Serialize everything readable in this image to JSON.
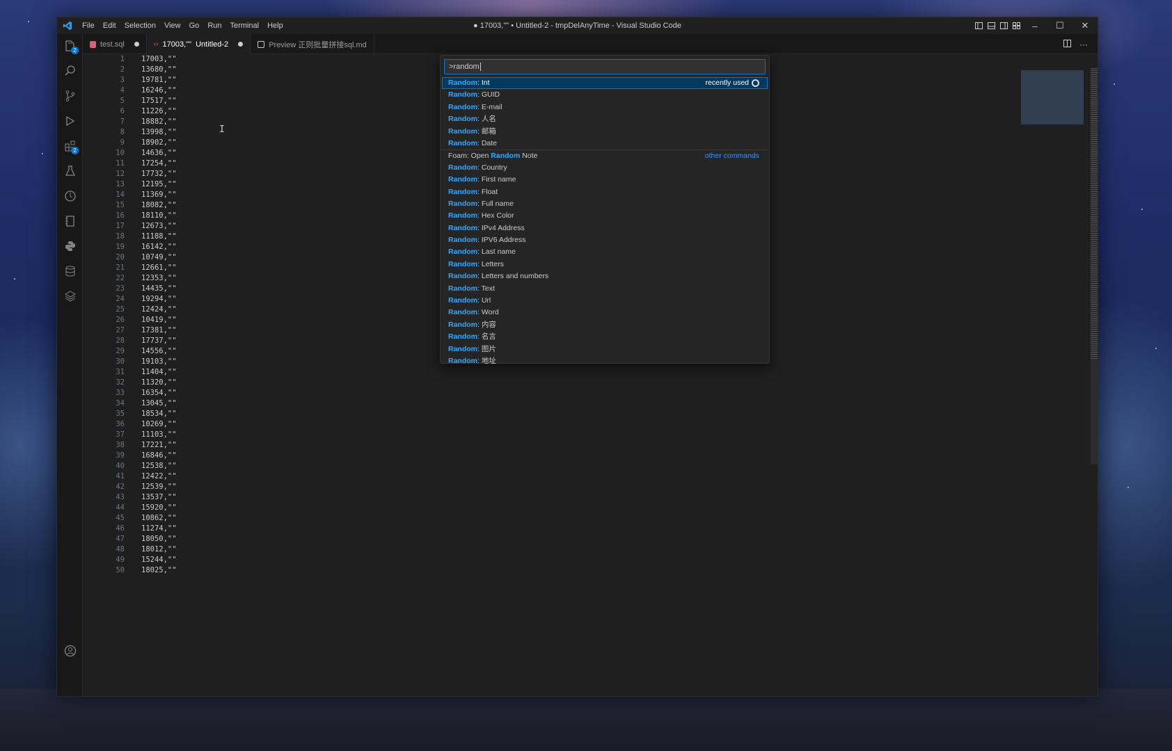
{
  "window": {
    "title": "● 17003,\"\" • Untitled-2 - tmpDelAnyTime - Visual Studio Code",
    "menu": [
      "File",
      "Edit",
      "Selection",
      "View",
      "Go",
      "Run",
      "Terminal",
      "Help"
    ],
    "controls": {
      "minimize": "–",
      "maximize": "☐",
      "close": "✕"
    }
  },
  "activity_bar": {
    "items": [
      {
        "icon": "explorer-icon",
        "badge": "2"
      },
      {
        "icon": "search-icon"
      },
      {
        "icon": "source-control-icon"
      },
      {
        "icon": "run-debug-icon"
      },
      {
        "icon": "extensions-icon",
        "badge": "2"
      },
      {
        "icon": "testing-icon"
      },
      {
        "icon": "timeline-icon"
      },
      {
        "icon": "notebook-icon"
      },
      {
        "icon": "python-icon"
      },
      {
        "icon": "database-icon"
      },
      {
        "icon": "layers-icon"
      }
    ],
    "bottom": {
      "icon": "account-icon"
    }
  },
  "tabs": [
    {
      "label": "test.sql",
      "dirty": true,
      "active": false,
      "color": "#e05d7a"
    },
    {
      "label": "17003,\"\"  Untitled-2",
      "dirty": true,
      "active": true,
      "color": "#e05d44"
    },
    {
      "label": "Preview 正则批量拼接sql.md",
      "dirty": false,
      "active": false,
      "color": "#cccccc"
    }
  ],
  "editor": {
    "lines": [
      "17003,\"\"",
      "13680,\"\"",
      "19781,\"\"",
      "16246,\"\"",
      "17517,\"\"",
      "11226,\"\"",
      "18882,\"\"",
      "13998,\"\"",
      "18902,\"\"",
      "14636,\"\"",
      "17254,\"\"",
      "17732,\"\"",
      "12195,\"\"",
      "11369,\"\"",
      "18082,\"\"",
      "18110,\"\"",
      "12673,\"\"",
      "11188,\"\"",
      "16142,\"\"",
      "10749,\"\"",
      "12661,\"\"",
      "12353,\"\"",
      "14435,\"\"",
      "19294,\"\"",
      "12424,\"\"",
      "10419,\"\"",
      "17381,\"\"",
      "17737,\"\"",
      "14556,\"\"",
      "19103,\"\"",
      "11404,\"\"",
      "11320,\"\"",
      "16354,\"\"",
      "13045,\"\"",
      "18534,\"\"",
      "10269,\"\"",
      "11103,\"\"",
      "17221,\"\"",
      "16846,\"\"",
      "12538,\"\"",
      "12422,\"\"",
      "12539,\"\"",
      "13537,\"\"",
      "15920,\"\"",
      "10862,\"\"",
      "11274,\"\"",
      "18050,\"\"",
      "18012,\"\"",
      "15244,\"\"",
      "18025,\"\""
    ]
  },
  "palette": {
    "input": ">random",
    "items": [
      {
        "prefix": "",
        "hl": "Random",
        "suffix": ": Int",
        "right": "recently used",
        "right_kind": "label",
        "selected": true
      },
      {
        "prefix": "",
        "hl": "Random",
        "suffix": ": GUID"
      },
      {
        "prefix": "",
        "hl": "Random",
        "suffix": ": E-mail"
      },
      {
        "prefix": "",
        "hl": "Random",
        "suffix": ": 人名"
      },
      {
        "prefix": "",
        "hl": "Random",
        "suffix": ": 邮箱"
      },
      {
        "prefix": "",
        "hl": "Random",
        "suffix": ": Date"
      },
      {
        "prefix": "Foam: Open ",
        "hl": "Random",
        "suffix": " Note",
        "right": "other commands",
        "right_kind": "link",
        "separator": true
      },
      {
        "prefix": "",
        "hl": "Random",
        "suffix": ": Country"
      },
      {
        "prefix": "",
        "hl": "Random",
        "suffix": ": First name"
      },
      {
        "prefix": "",
        "hl": "Random",
        "suffix": ": Float"
      },
      {
        "prefix": "",
        "hl": "Random",
        "suffix": ": Full name"
      },
      {
        "prefix": "",
        "hl": "Random",
        "suffix": ": Hex Color"
      },
      {
        "prefix": "",
        "hl": "Random",
        "suffix": ": IPv4 Address"
      },
      {
        "prefix": "",
        "hl": "Random",
        "suffix": ": IPV6 Address"
      },
      {
        "prefix": "",
        "hl": "Random",
        "suffix": ": Last name"
      },
      {
        "prefix": "",
        "hl": "Random",
        "suffix": ": Letters"
      },
      {
        "prefix": "",
        "hl": "Random",
        "suffix": ": Letters and numbers"
      },
      {
        "prefix": "",
        "hl": "Random",
        "suffix": ": Text"
      },
      {
        "prefix": "",
        "hl": "Random",
        "suffix": ": Url"
      },
      {
        "prefix": "",
        "hl": "Random",
        "suffix": ": Word"
      },
      {
        "prefix": "",
        "hl": "Random",
        "suffix": ": 内容"
      },
      {
        "prefix": "",
        "hl": "Random",
        "suffix": ": 名言"
      },
      {
        "prefix": "",
        "hl": "Random",
        "suffix": ": 图片"
      },
      {
        "prefix": "",
        "hl": "Random",
        "suffix": ": 地址"
      }
    ]
  },
  "colors": {
    "accent": "#0078d4",
    "highlight": "#2aaaff",
    "selected_bg": "#04395e",
    "editor_bg": "#1f1f1f"
  }
}
